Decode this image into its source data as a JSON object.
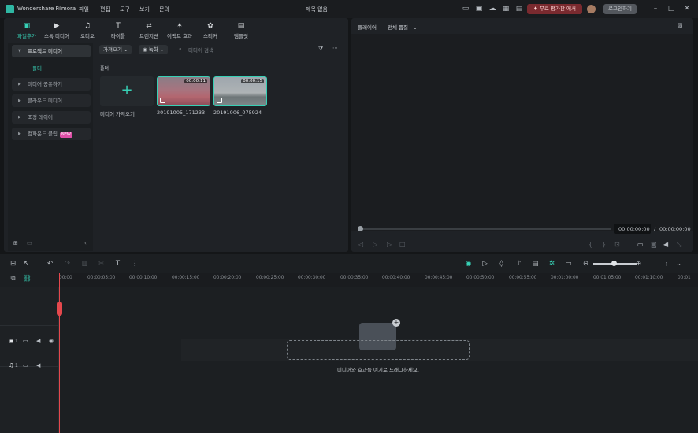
{
  "app": {
    "name": "Wondershare Filmora",
    "window_title": "제목 없음"
  },
  "menu": [
    "파일",
    "편집",
    "도구",
    "보기",
    "문의"
  ],
  "header": {
    "promo": "무료 평가판 에서",
    "login": "로그인하기"
  },
  "media_tabs": [
    {
      "label": "파일추가",
      "icon": "import-icon"
    },
    {
      "label": "스톡 미디어",
      "icon": "stock-media-icon"
    },
    {
      "label": "오디오",
      "icon": "music-icon"
    },
    {
      "label": "타이틀",
      "icon": "title-icon"
    },
    {
      "label": "트랜지션",
      "icon": "transition-icon"
    },
    {
      "label": "이펙트 효과",
      "icon": "effects-icon"
    },
    {
      "label": "스티커",
      "icon": "sticker-icon"
    },
    {
      "label": "템플릿",
      "icon": "template-icon"
    }
  ],
  "sidebar": {
    "project_media": "프로젝트 미디어",
    "folder": "폴더",
    "items": [
      "미디어 공유하기",
      "클라우드 미디어",
      "조정 레이어",
      "컴파운드 클립"
    ],
    "new_badge": "NEW"
  },
  "media_toolbar": {
    "import_dropdown": "가져오기",
    "record_dropdown": "녹화",
    "search_placeholder": "미디어 검색"
  },
  "media": {
    "folder_label": "폴더",
    "import_tile_label": "미디어 가져오기",
    "clips": [
      {
        "name": "20191005_171233",
        "duration": "00:00:11"
      },
      {
        "name": "20191006_075924",
        "duration": "00:00:15"
      }
    ]
  },
  "player": {
    "label": "플레이어",
    "quality": "전체 품질",
    "current_time": "00:00:00:00",
    "separator": "/",
    "total_time": "00:00:00:00"
  },
  "timeline": {
    "ruler": [
      "00:00",
      "00:00:05:00",
      "00:00:10:00",
      "00:00:15:00",
      "00:00:20:00",
      "00:00:25:00",
      "00:00:30:00",
      "00:00:35:00",
      "00:00:40:00",
      "00:00:45:00",
      "00:00:50:00",
      "00:00:55:00",
      "00:01:00:00",
      "00:01:05:00",
      "00:01:10:00",
      "00:01"
    ],
    "video_track_num": "1",
    "audio_track_num": "1",
    "drop_hint": "미디어와 효과를 여기로 드래그하세요."
  },
  "colors": {
    "accent": "#37d0b5",
    "playhead": "#e5484d",
    "promo_bg": "#7a2a2f"
  }
}
